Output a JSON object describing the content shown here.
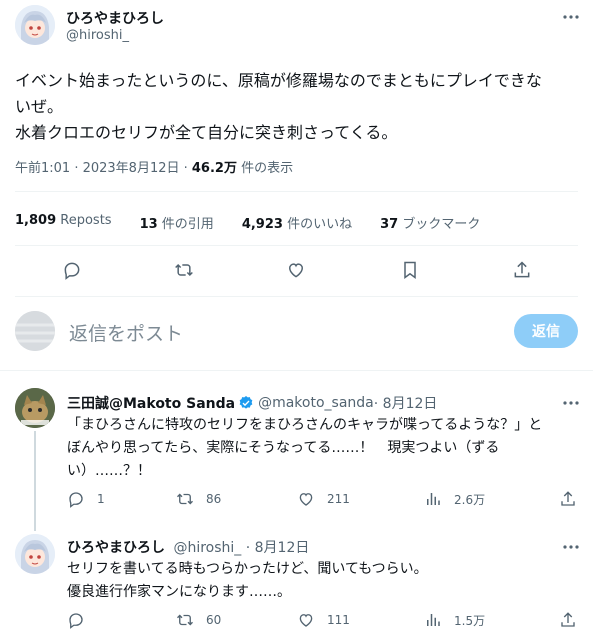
{
  "main_tweet": {
    "display_name": "ひろやまひろし",
    "handle": "@hiroshi_",
    "text_line1": "イベント始まったというのに、原稿が修羅場なのでまともにプレイできな",
    "text_line2": "いぜ。",
    "text_line3": "水着クロエのセリフが全て自分に突き刺さってくる。",
    "time": "午前1:01 · 2023年8月12日 · ",
    "views_count": "46.2万",
    "views_label": " 件の表示",
    "stats": {
      "reposts_count": "1,809",
      "reposts_label": "Reposts",
      "quotes_count": "13",
      "quotes_label": "件の引用",
      "likes_count": "4,923",
      "likes_label": "件のいいね",
      "bookmarks_count": "37",
      "bookmarks_label": "ブックマーク"
    }
  },
  "composer": {
    "placeholder": "返信をポスト",
    "reply_button": "返信"
  },
  "replies": [
    {
      "display_name": "三田誠@Makoto Sanda",
      "handle": "@makoto_sanda",
      "date": " · 8月12日",
      "line1": "「まひろさんに特攻のセリフをまひろさんのキャラが喋ってるような？」と",
      "line2": "ぼんやり思ってたら、実際にそうなってる……！　現実つよい（ずる",
      "line3": "い）……？！",
      "reply_count": "1",
      "repost_count": "86",
      "like_count": "211",
      "view_count": "2.6万"
    },
    {
      "display_name": "ひろやまひろし",
      "handle": "@hiroshi_",
      "date": " · 8月12日",
      "line1": "セリフを書いてる時もつらかったけど、聞いてもつらい。",
      "line2": "優良進行作家マンになります……。",
      "reply_count": "",
      "repost_count": "60",
      "like_count": "111",
      "view_count": "1.5万"
    }
  ],
  "colors": {
    "accent": "#1d9bf0",
    "verified": "#1d9bf0",
    "text": "#0f1419",
    "muted": "#536471",
    "divider": "#eff3f4"
  }
}
